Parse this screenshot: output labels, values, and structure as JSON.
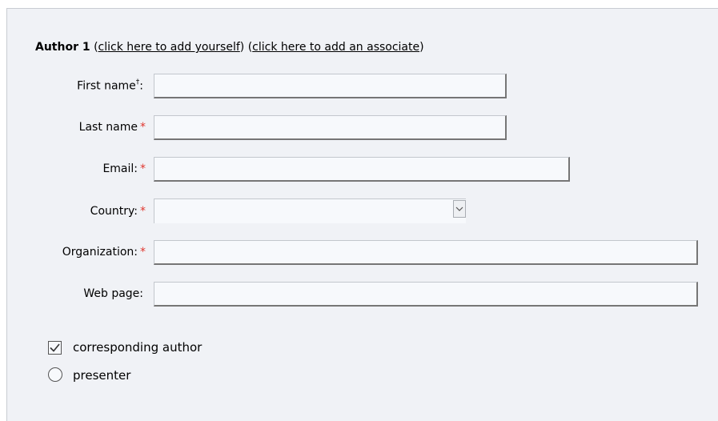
{
  "author_block": {
    "heading_bold": "Author 1",
    "add_yourself_link": "click here to add yourself",
    "add_associate_link": "click here to add an associate",
    "paren_open": "(",
    "paren_close": ")"
  },
  "fields": {
    "first_name": {
      "label": "First name",
      "dagger": "†",
      "suffix": ":",
      "value": ""
    },
    "last_name": {
      "label": "Last name",
      "required_mark": "*",
      "value": ""
    },
    "email": {
      "label": "Email:",
      "required_mark": "*",
      "value": ""
    },
    "country": {
      "label": "Country:",
      "required_mark": "*",
      "selected": ""
    },
    "organization": {
      "label": "Organization:",
      "required_mark": "*",
      "value": ""
    },
    "web_page": {
      "label": "Web page:",
      "value": ""
    }
  },
  "options": {
    "corresponding_author": {
      "label": "corresponding author",
      "checked": true
    },
    "presenter": {
      "label": "presenter",
      "checked": false
    }
  },
  "colors": {
    "panel_bg": "#f0f2f6",
    "required": "#e0362e",
    "field_bg": "#f7f9fc"
  },
  "icons": {
    "dropdown": "chevron-down-icon",
    "checkbox": "checkmark-icon",
    "radio": "radio-empty-icon"
  }
}
